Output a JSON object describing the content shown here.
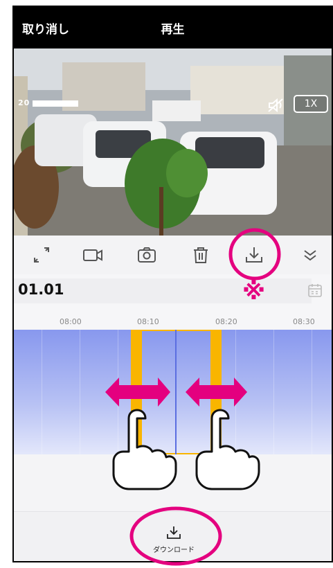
{
  "header": {
    "cancel_label": "取り消し",
    "title": "再生"
  },
  "video": {
    "timestamp_prefix": "20",
    "speed": "1X"
  },
  "toolbar": {
    "icons": [
      "fullscreen-icon",
      "record-video-icon",
      "snapshot-icon",
      "delete-icon",
      "download-icon",
      "collapse-icon"
    ]
  },
  "timeline": {
    "date": "01.01",
    "ticks": [
      "08:00",
      "08:10",
      "08:20",
      "08:30"
    ],
    "selection_handle_glyph": "II"
  },
  "annotation": {
    "note_mark": "※"
  },
  "bottom": {
    "download_label": "ダウンロード"
  },
  "colors": {
    "highlight": "#e4007f",
    "selection": "#f9b500",
    "track": "#8898ee"
  }
}
